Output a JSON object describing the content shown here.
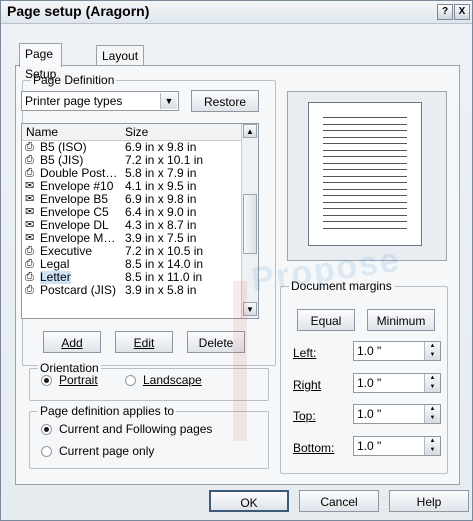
{
  "window": {
    "title": "Page setup (Aragorn)",
    "help_glyph": "?",
    "close_glyph": "X"
  },
  "tabs": [
    {
      "label": "Page Setup",
      "active": true
    },
    {
      "label": "Layout",
      "active": false
    }
  ],
  "page_definition": {
    "group_label": "Page Definition",
    "type_select": {
      "value": "Printer page types"
    },
    "restore_label": "Restore",
    "columns": [
      "Name",
      "Size"
    ],
    "paper_list": [
      {
        "name": "B5 (ISO)",
        "size": "6.9 in x 9.8 in",
        "icon": "printer-icon",
        "selected": false
      },
      {
        "name": "B5 (JIS)",
        "size": "7.2 in x 10.1 in",
        "icon": "printer-icon",
        "selected": false
      },
      {
        "name": "Double Post…",
        "size": "5.8 in x 7.9 in",
        "icon": "printer-icon",
        "selected": false
      },
      {
        "name": "Envelope #10",
        "size": "4.1 in x 9.5 in",
        "icon": "envelope-icon",
        "selected": false
      },
      {
        "name": "Envelope B5",
        "size": "6.9 in x 9.8 in",
        "icon": "envelope-icon",
        "selected": false
      },
      {
        "name": "Envelope C5",
        "size": "6.4 in x 9.0 in",
        "icon": "envelope-icon",
        "selected": false
      },
      {
        "name": "Envelope DL",
        "size": "4.3 in x 8.7 in",
        "icon": "envelope-icon",
        "selected": false
      },
      {
        "name": "Envelope M…",
        "size": "3.9 in x 7.5 in",
        "icon": "envelope-icon",
        "selected": false
      },
      {
        "name": "Executive",
        "size": "7.2 in x 10.5 in",
        "icon": "printer-icon",
        "selected": false
      },
      {
        "name": "Legal",
        "size": "8.5 in x 14.0 in",
        "icon": "printer-icon",
        "selected": false
      },
      {
        "name": "Letter",
        "size": "8.5 in x 11.0 in",
        "icon": "printer-icon",
        "selected": true
      },
      {
        "name": "Postcard (JIS)",
        "size": "3.9 in x 5.8 in",
        "icon": "printer-icon",
        "selected": false
      }
    ],
    "add_label": "Add",
    "edit_label": "Edit",
    "delete_label": "Delete"
  },
  "orientation": {
    "group_label": "Orientation",
    "portrait_label": "Portrait",
    "landscape_label": "Landscape",
    "selected": "Portrait"
  },
  "applies_to": {
    "group_label": "Page definition applies to",
    "option_current_following": "Current and Following pages",
    "option_current_only": "Current page only",
    "selected": "Current and Following pages"
  },
  "margins": {
    "group_label": "Document margins",
    "equal_label": "Equal",
    "minimum_label": "Minimum",
    "fields": [
      {
        "label": "Left:",
        "value": "1.0 \""
      },
      {
        "label": "Right",
        "value": "1.0 \""
      },
      {
        "label": "Top:",
        "value": "1.0 \""
      },
      {
        "label": "Bottom:",
        "value": "1.0 \""
      }
    ]
  },
  "footer": {
    "ok_label": "OK",
    "cancel_label": "Cancel",
    "help_label": "Help"
  },
  "watermark_text": "Propose"
}
